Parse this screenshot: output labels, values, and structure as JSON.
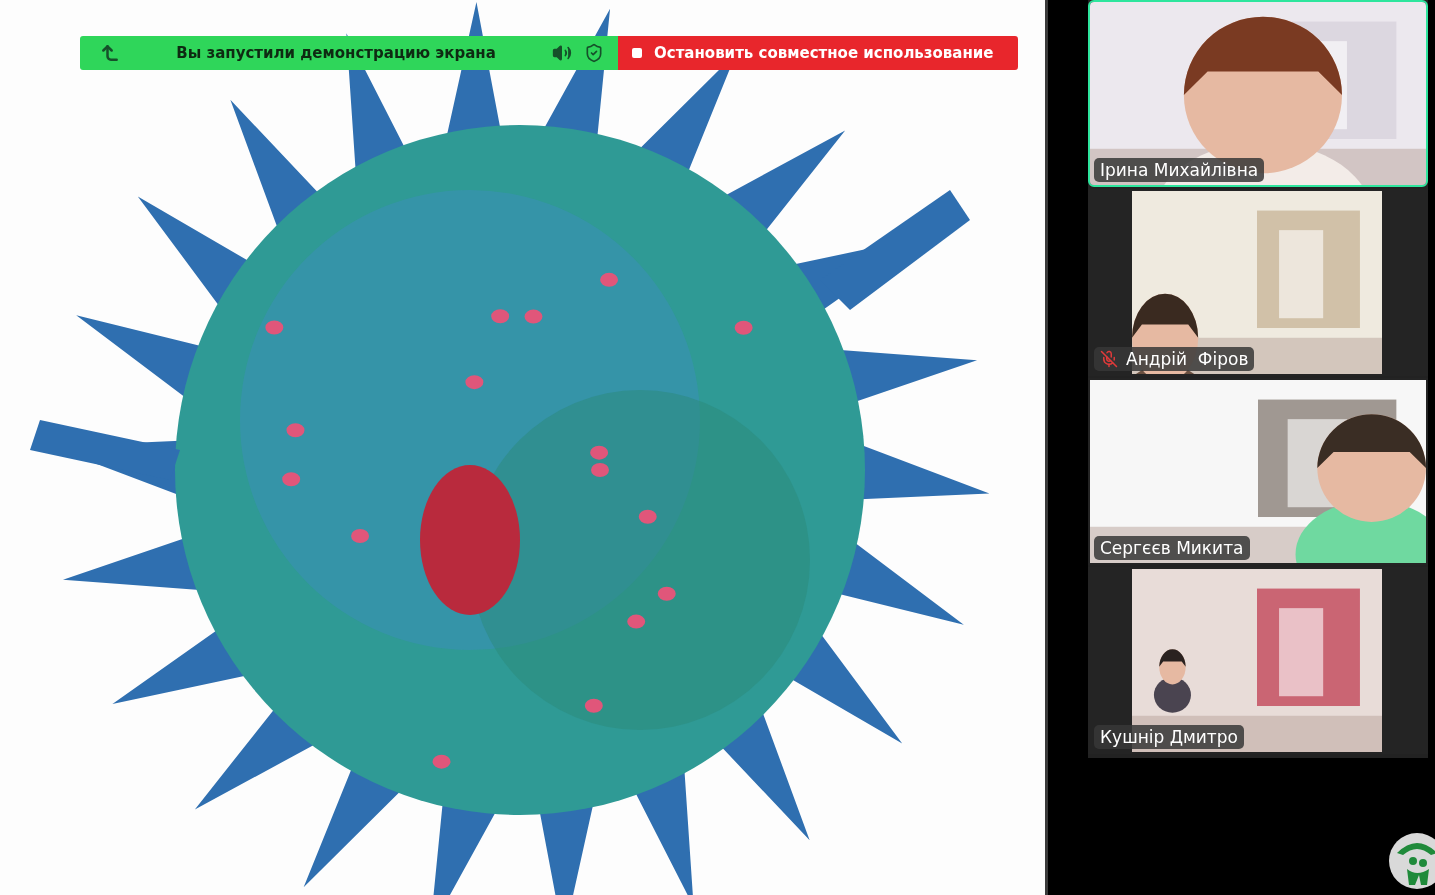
{
  "share_banner": {
    "message": "Вы запустили демонстрацию экрана",
    "stop_button": "Остановить совместное использование"
  },
  "participants": [
    {
      "name": "Ірина Михайлівна",
      "active_speaker": true,
      "muted": false,
      "kind": "full"
    },
    {
      "name": "Андрій  Фіров",
      "active_speaker": false,
      "muted": true,
      "kind": "pillarbox"
    },
    {
      "name": "Сергєєв Микита",
      "active_speaker": false,
      "muted": false,
      "kind": "full"
    },
    {
      "name": "Кушнір Дмитро",
      "active_speaker": false,
      "muted": false,
      "kind": "pillarbox"
    }
  ]
}
